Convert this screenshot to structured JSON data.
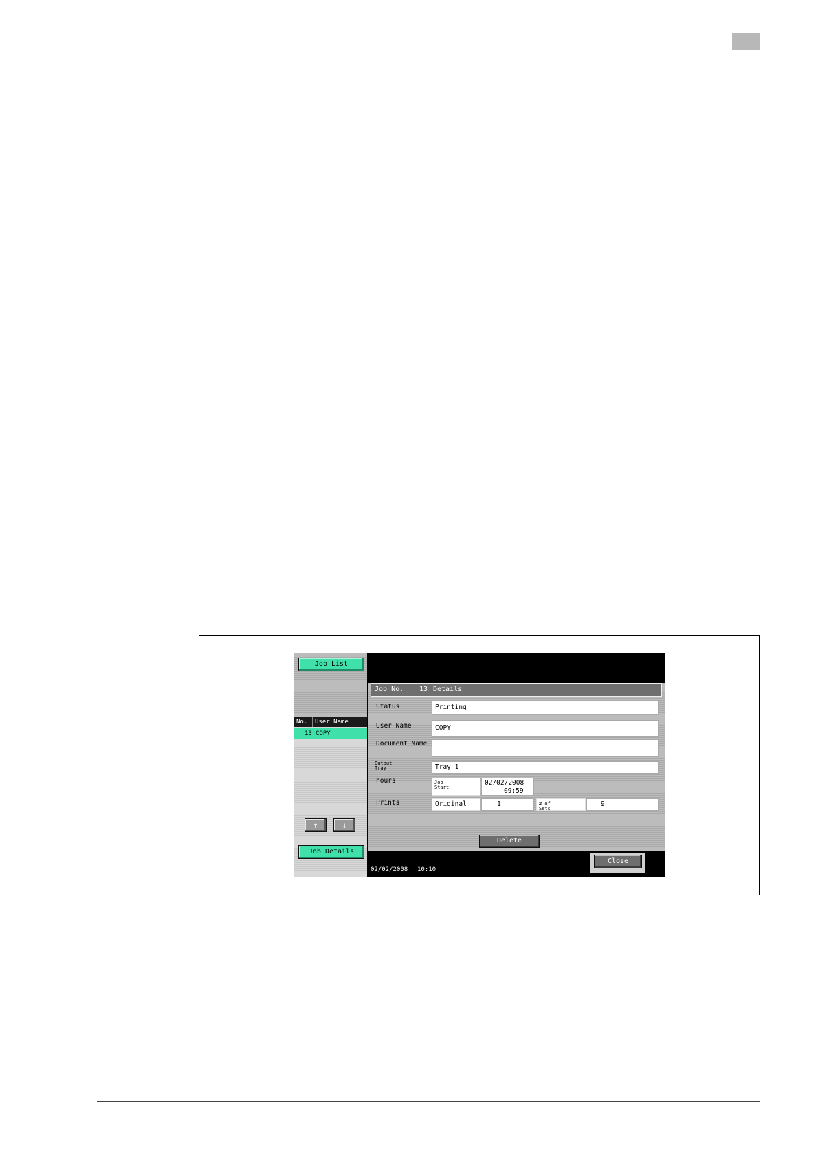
{
  "left": {
    "job_list_label": "Job List",
    "list_header": {
      "no": "No.",
      "user_name": "User Name"
    },
    "rows": [
      {
        "no": "13",
        "user_name": "COPY"
      }
    ],
    "up_label": "↑",
    "down_label": "↓",
    "job_details_label": "Job Details"
  },
  "details": {
    "title_prefix": "Job No.",
    "job_no": "13",
    "title_suffix": "Details",
    "status_label": "Status",
    "status_value": "Printing",
    "user_name_label": "User Name",
    "user_name_value": "COPY",
    "document_name_label": "Document Name",
    "document_name_value": "",
    "output_tray_label": "Output Tray",
    "output_tray_value": "Tray 1",
    "hours_label": "hours",
    "job_start_label": "Job Start",
    "job_start_date": "02/02/2008",
    "job_start_time": "09:59",
    "prints_label": "Prints",
    "original_label": "Original",
    "original_value": "1",
    "sets_label": "# of Sets",
    "sets_value": "9",
    "delete_label": "Delete"
  },
  "status_bar": {
    "date": "02/02/2008",
    "time": "10:10",
    "close_label": "Close"
  }
}
